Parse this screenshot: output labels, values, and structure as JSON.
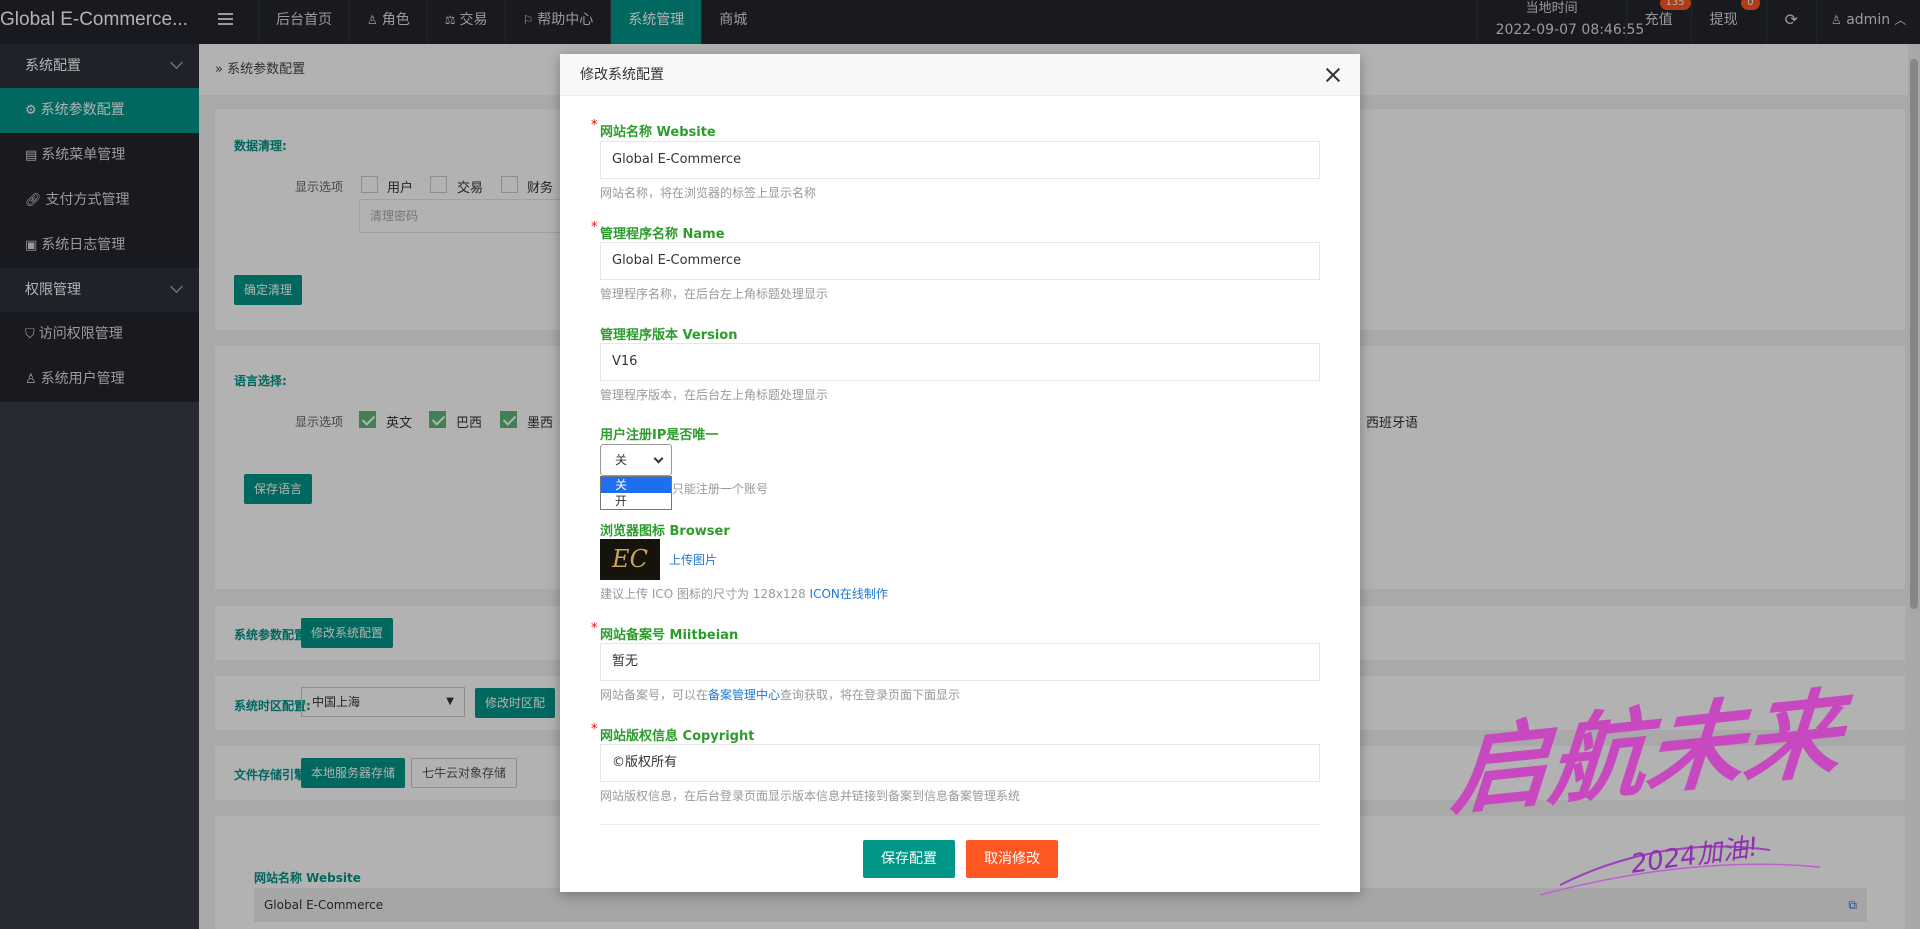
{
  "header": {
    "logo": "Global E-Commerce...",
    "nav": [
      {
        "label": "后台首页",
        "icon": ""
      },
      {
        "label": "角色",
        "icon": "user-icon"
      },
      {
        "label": "交易",
        "icon": "scale-icon"
      },
      {
        "label": "帮助中心",
        "icon": "flag-icon"
      },
      {
        "label": "系统管理",
        "icon": ""
      },
      {
        "label": "商城",
        "icon": ""
      }
    ],
    "time_label": "当地时间",
    "time_value": "2022-09-07 08:46:55",
    "recharge_label": "充值",
    "recharge_badge": "135",
    "withdraw_label": "提现",
    "withdraw_badge": "0",
    "user_label": "admin"
  },
  "sidebar": {
    "group1": "系统配置",
    "items1": [
      "系统参数配置",
      "系统菜单管理",
      "支付方式管理",
      "系统日志管理"
    ],
    "group2": "权限管理",
    "items2": [
      "访问权限管理",
      "系统用户管理"
    ]
  },
  "content": {
    "breadcrumb": "系统参数配置",
    "clean_title": "数据清理:",
    "clean_options_label": "显示选项",
    "clean_options": [
      "用户",
      "交易",
      "财务"
    ],
    "clean_pwd_placeholder": "清理密码",
    "clean_button": "确定清理",
    "lang_title": "语言选择:",
    "lang_options_label": "显示选项",
    "lang_options": [
      "英文",
      "巴西",
      "墨西"
    ],
    "lang_right": "西班牙语",
    "lang_button": "保存语言",
    "sysparam_title": "系统参数配置:",
    "sysparam_button": "修改系统配置",
    "tz_title": "系统时区配置:",
    "tz_value": "中国上海",
    "tz_button": "修改时区配",
    "storage_title": "文件存储引擎:",
    "storage_btn1": "本地服务器存储",
    "storage_btn2": "七牛云对象存储",
    "website_label": "网站名称 Website",
    "website_value": "Global E-Commerce"
  },
  "modal": {
    "title": "修改系统配置",
    "website_label": "网站名称 Website",
    "website_value": "Global E-Commerce",
    "website_help": "网站名称，将在浏览器的标签上显示名称",
    "name_label": "管理程序名称 Name",
    "name_value": "Global E-Commerce",
    "name_help": "管理程序名称，在后台左上角标题处理显示",
    "version_label": "管理程序版本 Version",
    "version_value": "V16",
    "version_help": "管理程序版本，在后台左上角标题处理显示",
    "ip_label": "用户注册IP是否唯一",
    "ip_selected": "关",
    "ip_options": [
      "关",
      "开"
    ],
    "ip_help": "只能注册一个账号",
    "browser_label": "浏览器图标 Browser",
    "browser_icon_text": "EC",
    "upload_label": "上传图片",
    "browser_help": "建议上传 ICO 图标的尺寸为 128x128",
    "browser_link": "ICON在线制作",
    "beian_label": "网站备案号 Miitbeian",
    "beian_value": "暂无",
    "beian_help_1": "网站备案号，可以在",
    "beian_help_link": "备案管理中心",
    "beian_help_2": "查询获取，将在登录页面下面显示",
    "copyright_label": "网站版权信息 Copyright",
    "copyright_value": "©版权所有",
    "copyright_help": "网站版权信息，在后台登录页面显示版本信息并链接到备案到信息备案管理系统",
    "save_button": "保存配置",
    "cancel_button": "取消修改"
  },
  "watermark": {
    "main": "启航未来",
    "sub": "2024加油!"
  }
}
